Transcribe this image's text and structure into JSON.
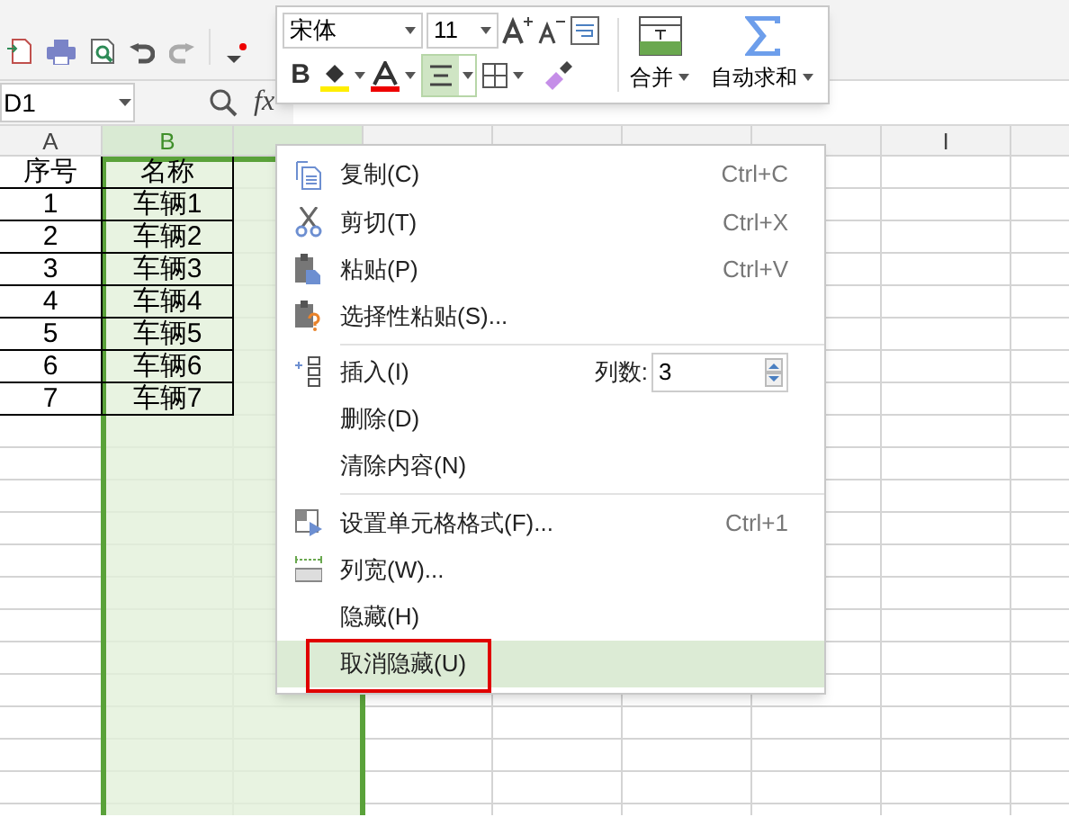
{
  "name_box": {
    "value": "D1"
  },
  "formula_bar": {
    "fx_label": "fx"
  },
  "columns": [
    {
      "label": "A",
      "selected": false
    },
    {
      "label": "B",
      "selected": true
    },
    {
      "selected": true
    },
    {
      "selected": false
    },
    {
      "selected": false
    },
    {
      "selected": false
    },
    {
      "selected": false
    },
    {
      "label": "I",
      "selected": false
    }
  ],
  "rows": [
    [
      "序号",
      "名称"
    ],
    [
      "1",
      "车辆1"
    ],
    [
      "2",
      "车辆2"
    ],
    [
      "3",
      "车辆3"
    ],
    [
      "4",
      "车辆4"
    ],
    [
      "5",
      "车辆5"
    ],
    [
      "6",
      "车辆6"
    ],
    [
      "7",
      "车辆7"
    ]
  ],
  "mini_toolbar": {
    "font": "宋体",
    "size": "11",
    "bold_label": "B",
    "align_selected": true,
    "merge": "合并",
    "autosum": "自动求和"
  },
  "context_menu": [
    {
      "kind": "item",
      "label": "复制(C)",
      "shortcut": "Ctrl+C",
      "selected": false
    },
    {
      "kind": "item",
      "label": "剪切(T)",
      "shortcut": "Ctrl+X",
      "selected": false
    },
    {
      "kind": "item",
      "label": "粘贴(P)",
      "shortcut": "Ctrl+V",
      "selected": false
    },
    {
      "kind": "item",
      "label": "选择性粘贴(S)...",
      "selected": false
    },
    {
      "kind": "separator"
    },
    {
      "kind": "spinner",
      "label": "插入(I)",
      "spinner_label": "列数:",
      "value": "3",
      "selected": false
    },
    {
      "kind": "item",
      "label": "删除(D)",
      "selected": false
    },
    {
      "kind": "item",
      "label": "清除内容(N)",
      "selected": false
    },
    {
      "kind": "separator"
    },
    {
      "kind": "item",
      "label": "设置单元格格式(F)...",
      "shortcut": "Ctrl+1",
      "selected": false
    },
    {
      "kind": "item",
      "label": "列宽(W)...",
      "selected": false
    },
    {
      "kind": "item",
      "label": "隐藏(H)",
      "selected": false
    },
    {
      "kind": "item",
      "label": "取消隐藏(U)",
      "selected": true,
      "outlined": true
    }
  ]
}
